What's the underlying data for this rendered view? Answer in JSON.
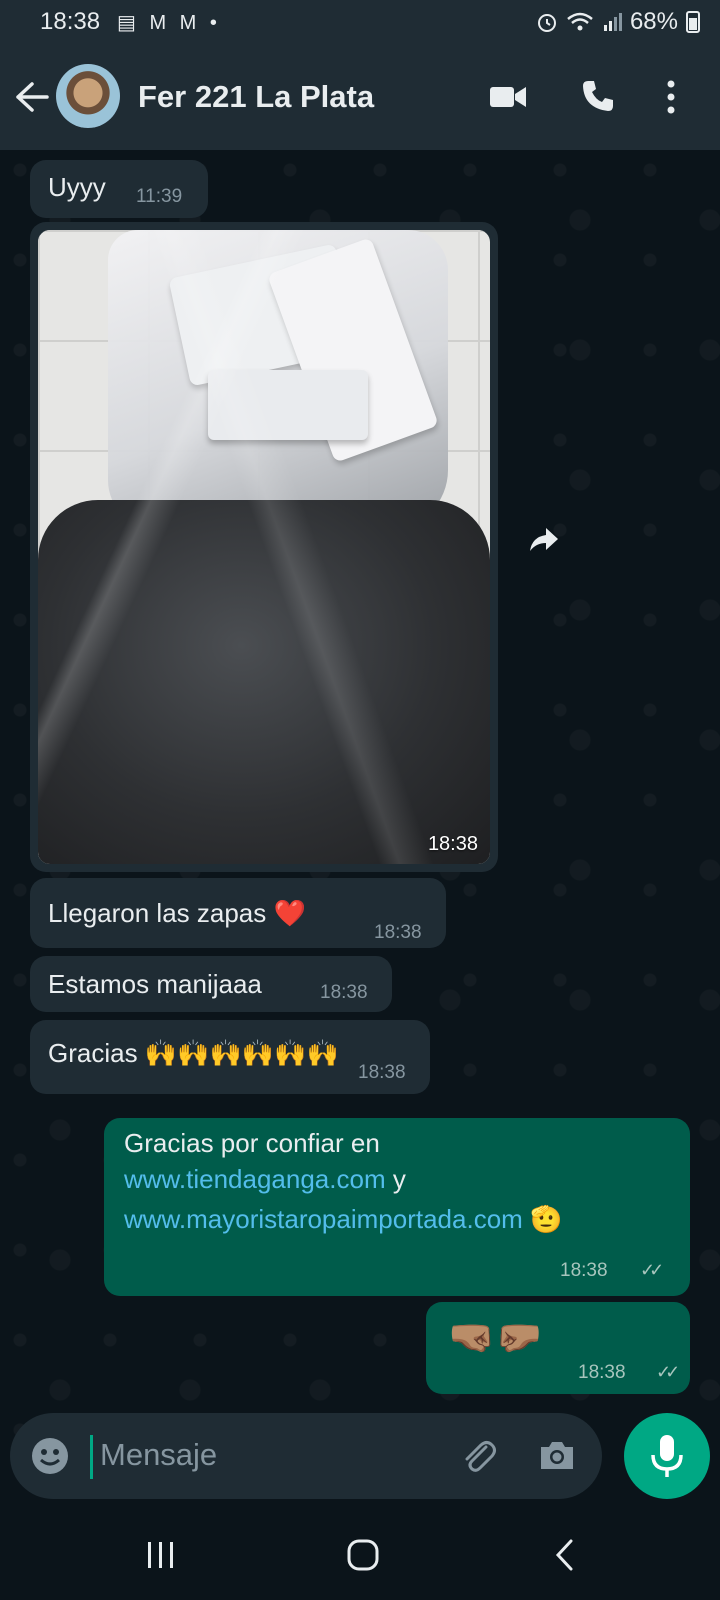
{
  "status_bar": {
    "time": "18:38",
    "left_icons": "▤ M M •",
    "battery": "68%"
  },
  "header": {
    "title": "Fer 221 La Plata",
    "icons": [
      "back-arrow-icon",
      "video-call-icon",
      "phone-icon",
      "more-options-icon"
    ]
  },
  "messages": [
    {
      "type": "in",
      "text": "Uyyy",
      "time": "11:39"
    },
    {
      "type": "in-image",
      "time": "18:38"
    },
    {
      "type": "in",
      "text": "Llegaron las zapas ❤️",
      "time": "18:38"
    },
    {
      "type": "in",
      "text": "Estamos manijaaa",
      "time": "18:38"
    },
    {
      "type": "in",
      "text": "Gracias 🙌🙌🙌🙌🙌🙌",
      "time": "18:38"
    },
    {
      "type": "out",
      "line1": "Gracias por confiar en",
      "link1": "www.tiendaganga.com",
      "joiner": " y",
      "link2": "www.mayoristaropaimportada.com",
      "emoji": "🫡",
      "time": "18:38"
    },
    {
      "type": "out",
      "text": "🤜🏽🤛🏽",
      "time": "18:38"
    }
  ],
  "input": {
    "placeholder": "Mensaje"
  },
  "colors": {
    "background": "#0b141a",
    "bar": "#1f2c34",
    "incoming": "#1f2c34",
    "outgoing": "#005c4b",
    "accent": "#00a884",
    "link": "#53bdeb"
  }
}
